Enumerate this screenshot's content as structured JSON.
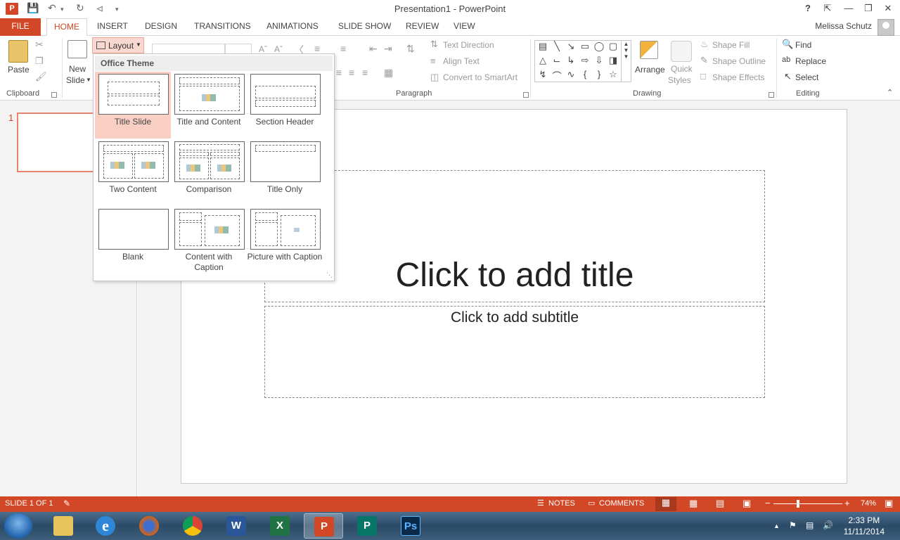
{
  "titlebar": {
    "app_icon": "P",
    "title": "Presentation1 - PowerPoint",
    "help": "?",
    "window_buttons": [
      "ribbon-display-icon",
      "minimize-icon",
      "restore-icon",
      "close-icon"
    ]
  },
  "tabs": [
    "FILE",
    "HOME",
    "INSERT",
    "DESIGN",
    "TRANSITIONS",
    "ANIMATIONS",
    "SLIDE SHOW",
    "REVIEW",
    "VIEW"
  ],
  "active_tab": "HOME",
  "user": "Melissa Schutz",
  "ribbon": {
    "clipboard": {
      "paste": "Paste",
      "label": "Clipboard"
    },
    "slides": {
      "new_slide_line1": "New",
      "new_slide_line2": "Slide",
      "layout": "Layout"
    },
    "paragraph": {
      "label": "Paragraph",
      "text_direction": "Text Direction",
      "align_text": "Align Text",
      "convert_smartart": "Convert to SmartArt"
    },
    "drawing": {
      "label": "Drawing",
      "arrange": "Arrange",
      "quick_styles_line1": "Quick",
      "quick_styles_line2": "Styles",
      "shape_fill": "Shape Fill",
      "shape_outline": "Shape Outline",
      "shape_effects": "Shape Effects"
    },
    "editing": {
      "label": "Editing",
      "find": "Find",
      "replace": "Replace",
      "select": "Select"
    }
  },
  "layout_menu": {
    "header": "Office Theme",
    "items": [
      {
        "label": "Title Slide",
        "selected": true
      },
      {
        "label": "Title and Content"
      },
      {
        "label": "Section Header"
      },
      {
        "label": "Two Content"
      },
      {
        "label": "Comparison"
      },
      {
        "label": "Title Only"
      },
      {
        "label": "Blank"
      },
      {
        "label": "Content with Caption"
      },
      {
        "label": "Picture with Caption"
      }
    ]
  },
  "thumbnails": {
    "slide_number": "1"
  },
  "slide": {
    "title_placeholder": "Click to add title",
    "subtitle_placeholder": "Click to add subtitle"
  },
  "statusbar": {
    "slide_info": "SLIDE 1 OF 1",
    "notes": "NOTES",
    "comments": "COMMENTS",
    "zoom": "74%"
  },
  "taskbar": {
    "apps": [
      "Windows Explorer",
      "Internet Explorer",
      "Firefox",
      "Chrome",
      "Word",
      "Excel",
      "PowerPoint",
      "Publisher",
      "Photoshop"
    ],
    "time": "2:33 PM",
    "date": "11/11/2014"
  },
  "colors": {
    "accent": "#d24726",
    "selection": "#f9cfc3"
  }
}
